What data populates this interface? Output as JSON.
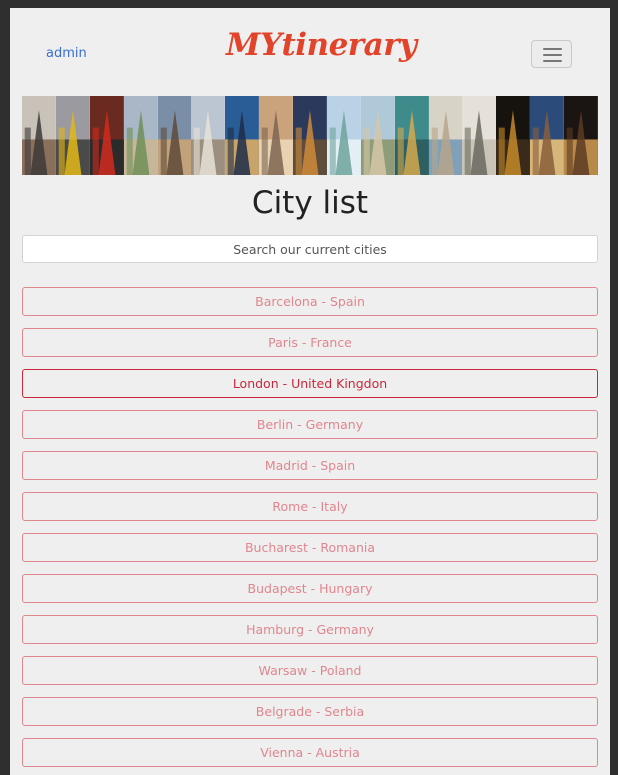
{
  "navbar": {
    "admin_label": "admin",
    "logo_text": "MYtinerary",
    "menu_icon": "hamburger-icon"
  },
  "banner": {
    "tiles": [
      "prague-tyn-church",
      "new-york-taxi",
      "london-phone-box",
      "champs-elysees",
      "tower-bridge",
      "rome-vittoriano",
      "berlin-tv-tower",
      "budapest-bridge",
      "big-ben",
      "statue-of-liberty",
      "vienna-palace",
      "astronomical-clock",
      "trevi-fountain",
      "eiffel-tower",
      "colosseum-night",
      "prague-tyn-church-dusk",
      "colosseum-dark"
    ]
  },
  "main": {
    "title": "City list",
    "search_placeholder": "Search our current cities"
  },
  "cities": [
    {
      "label": "Barcelona - Spain",
      "active": false
    },
    {
      "label": "Paris - France",
      "active": false
    },
    {
      "label": "London - United Kingdon",
      "active": true
    },
    {
      "label": "Berlin - Germany",
      "active": false
    },
    {
      "label": "Madrid - Spain",
      "active": false
    },
    {
      "label": "Rome - Italy",
      "active": false
    },
    {
      "label": "Bucharest - Romania",
      "active": false
    },
    {
      "label": "Budapest - Hungary",
      "active": false
    },
    {
      "label": "Hamburg - Germany",
      "active": false
    },
    {
      "label": "Warsaw - Poland",
      "active": false
    },
    {
      "label": "Belgrade - Serbia",
      "active": false
    },
    {
      "label": "Vienna - Austria",
      "active": false
    }
  ],
  "colors": {
    "logo": "#e1432b",
    "link": "#3a6fd0",
    "city_border": "#e0868e",
    "city_active": "#c8283b",
    "background": "#efefef"
  }
}
